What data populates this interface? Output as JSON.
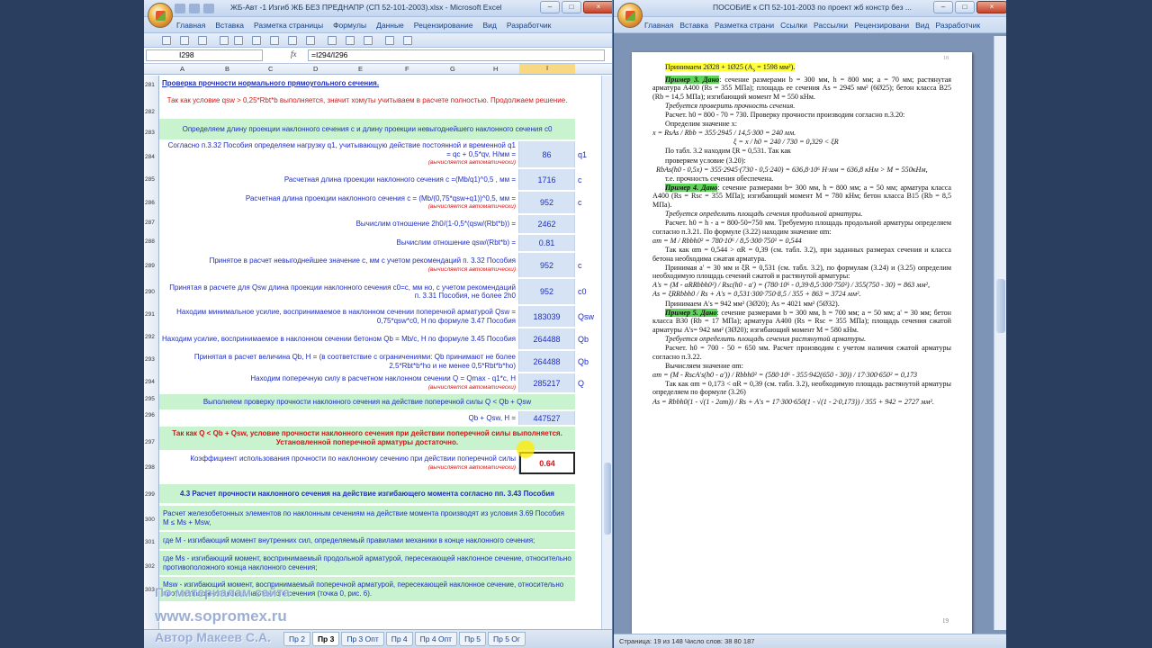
{
  "excel": {
    "title": "ЖБ-Авт -1 Изгиб ЖБ БЕЗ ПРЕДНАПР (СП 52-101-2003).xlsx - Microsoft Excel",
    "tabs": [
      "Главная",
      "Вставка",
      "Разметка страницы",
      "Формулы",
      "Данные",
      "Рецензирование",
      "Вид",
      "Разработчик"
    ],
    "name_box": "I298",
    "fx_label": "fx",
    "formula": "=I294/I296",
    "columns": [
      "A",
      "B",
      "C",
      "D",
      "E",
      "F",
      "G",
      "H",
      "I"
    ],
    "auto_note": "(вычисляется автоматически)",
    "heading": "Проверка прочности нормального прямоугольного сечения.",
    "red_note": "Так как условие qsw > 0,25*Rbt*b выполняется, значит хомуты учитываем в расчете полностью. Продолжаем решение.",
    "band_c0": "Определяем длину проекции наклонного сечения с и длину проекции невыгоднейшего наклонного сечения с0",
    "rows": [
      {
        "num": "284",
        "desc": "Согласно п.3.32 Пособия определяем нагрузку q1, учитывающую действие постоянной и временной q1 = qc + 0,5*qv, Н/мм =",
        "value": "86",
        "unit": "q1"
      },
      {
        "num": "285",
        "desc": "Расчетная длина проекции наклонного сечения с =(Mb/q1)^0,5 , мм =",
        "value": "1716",
        "unit": "c"
      },
      {
        "num": "286",
        "desc": "Расчетная длина проекции наклонного сечения  с = (Mb/(0,75*qsw+q1))^0,5, мм  =",
        "value": "952",
        "unit": "c"
      },
      {
        "num": "287",
        "desc": "Вычислим отношение    2h0/(1-0,5*(qsw/(Rbt*b)) =",
        "value": "2462",
        "unit": ""
      },
      {
        "num": "288",
        "desc": "Вычислим отношение  qsw/(Rbt*b) =",
        "value": "0.81",
        "unit": ""
      },
      {
        "num": "289",
        "desc": "Принятое в расчет невыгоднейшее значение с, мм с учетом рекомендаций п. 3.32 Пособия",
        "value": "952",
        "unit": "c"
      },
      {
        "num": "290",
        "desc": "Принятая в расчете для Qsw длина проекции наклонного сечения с0=с, мм но, с учетом рекомендаций п. 3.31 Пособия, не более 2h0",
        "value": "952",
        "unit": "c0"
      },
      {
        "num": "291",
        "desc": "Находим минимальное усилие, воспринимаемое в наклонном сечении поперечной арматурой Qsw = 0,75*qsw*c0, Н  по формуле 3.47 Пособия",
        "value": "183039",
        "unit": "Qsw"
      },
      {
        "num": "292",
        "desc": "Находим усилие, воспринимаемое в наклонном сечении бетоном Qb = Mb/c, Н  по формуле 3.45 Пособия",
        "value": "264488",
        "unit": "Qb"
      },
      {
        "num": "293",
        "desc": "Принятая в расчет величина Qb, Н  = (в соответствие с ограничениями: Qb принимают не более 2,5*Rbt*b*ho и не менее 0,5*Rbt*b*ho)",
        "value": "264488",
        "unit": "Qb"
      },
      {
        "num": "294",
        "desc": "Находим поперечную силу в расчетном наклонном сечении Q = Qmax - q1*c, Н",
        "value": "285217",
        "unit": "Q"
      }
    ],
    "band_check": "Выполняем проверку прочности наклонного сечения на действие поперечной силы Q < Qb + Qsw",
    "row_sum": {
      "desc": "Qb + Qsw, Н =",
      "value": "447527"
    },
    "conclusion": "Так как Q < Qb + Qsw, условие прочности наклонного сечения при действии поперечной силы выполняется. Установленной поперечной арматуры достаточно.",
    "row_coef": {
      "desc": "Коэффициент использования прочности по наклонному сечению при действии поперечной силы",
      "value": "0.64"
    },
    "section43": "4.3 Расчет прочности наклонного сечения на действие изгибающего момента согласно пп. 3.43 Пособия",
    "moment_rows": [
      "Расчет железобетонных элементов по наклонным сечениям на действие момента производят из условия 3.69 Пособия     M ≤ Ms + Msw,",
      "где M  - изгибающий момент внутренних сил, определяемый правилами механики в конце наклонного сечения;",
      "где Ms - изгибающий момент, воспринимаемый продольной арматурой, пересекающей наклонное сечение, относительно противоположного конца наклонного сечения;",
      "Msw - изгибающий момент, воспринимаемый поперечной арматурой, пересекающей наклонное сечение, относительно противоположного конца наклонного сечения (точка 0, рис. 6)."
    ],
    "sheets": [
      "Пр 2",
      "Пр 3",
      "Пр 3 Опт",
      "Пр 4",
      "Пр 4 Опт",
      "Пр 5",
      "Пр 5 Ог"
    ],
    "active_sheet": "Пр 3",
    "row_numbers": [
      "281",
      "282",
      "283",
      "284",
      "285",
      "286",
      "287",
      "288",
      "289",
      "290",
      "291",
      "292",
      "293",
      "294",
      "295",
      "296",
      "297",
      "298",
      "299",
      "300",
      "301",
      "302",
      "303"
    ]
  },
  "word": {
    "title": "ПОСОБИЕ к СП 52-101-2003 по проект жб констр без ...",
    "tabs": [
      "Главная",
      "Вставка",
      "Разметка страни",
      "Ссылки",
      "Рассылки",
      "Рецензировани",
      "Вид",
      "Разработчик"
    ],
    "page_top_number": "18",
    "line_accept_1": "Принимаем 2Ø28 + 1Ø25 (A",
    "line_accept_1b": "s",
    "line_accept_1c": " = 1598 мм²).",
    "ex3_label": "Пример 3. Дано",
    "ex3_text": ": сечение размерами b = 300 мм, h = 800 мм; a = 70 мм; растянутая арматура А400 (Rs = 355 МПа); площадь ее сечения As = 2945 мм² (6Ø25); бетон класса В25 (Rb = 14,5 МПа); изгибающий момент M = 550 кНм.",
    "ex3_req": "Требуется проверить прочность сечения.",
    "ex3_calc": "Расчет. h0 = 800 - 70 = 730. Проверку прочности производим согласно п.3.20:",
    "ex3_x": "Определим значение x:",
    "f1": "x = RsAs / Rbb = 355·2945 / 14,5·300 = 240 мм.",
    "f2": "ξ = x / h0 = 240 / 730 = 0,329 < ξR",
    "ex3_table": "По табл. 3.2 находим ξR = 0,531. Так как",
    "ex3_check": "проверяем условие (3.20):",
    "f3": "RbAs(h0 - 0,5x) = 355·2945·(730 - 0,5·240) = 636,8·10⁶ Н·мм = 636,8 кНм > M = 550кНм,",
    "ex3_result": "т.е. прочность сечения обеспечена.",
    "ex4_label": "Пример 4. Дано",
    "ex4_text": ": сечение размерами b= 300 мм, h = 800 мм; a = 50 мм; арматура класса А400 (Rs = Rsc = 355 МПа); изгибающий момент M = 780 кНм; бетон класса В15 (Rb = 8,5 МПа).",
    "ex4_req": "Требуется определить площадь сечения продольной арматуры.",
    "ex4_calc": "Расчет. h0 = h - a = 800-50=750 мм. Требуемую площадь продольной арматуры определяем согласно п.3.21. По формуле (3.22) находим значение αm:",
    "f4": "αm = M / Rbbh0² = 780·10⁶ / 8,5·300·750² = 0,544",
    "ex4_p1": "Так как αm = 0,544 > αR = 0,39 (см. табл. 3.2), при заданных размерах сечения и класса бетона необходима сжатая арматура.",
    "ex4_p2": "Принимая a' = 30 мм и ξR = 0,531 (см. табл. 3.2), по формулам (3.24) и (3.25) определим необходимую площадь сечений сжатой и растянутой арматуры:",
    "f5": "A's = (M - αRRbbh0²) / Rsc(h0 - a') = (780·10⁶ - 0,39·8,5·300·750²) / 355(750 - 30) = 863 мм²,",
    "f6": "As = ξRRbbh0 / Rs + A's = 0,531·300·750·8,5 / 355 + 863 = 3724 мм².",
    "ex4_accept": "Принимаем A's = 942 мм² (3Ø20); As = 4021 мм² (5Ø32).",
    "ex5_label": "Пример 5. Дано",
    "ex5_text": ": сечение размерами b = 300 мм, h = 700 мм; a = 50 мм; a' = 30 мм; бетон класса В30 (Rb = 17 МПа); арматура А400 (Rs = Rsc = 355 МПа); площадь сечения сжатой арматуры A's= 942 мм² (3Ø20); изгибающий момент M = 580 кНм.",
    "ex5_req": "Требуется определить площадь сечения растянутой арматуры.",
    "ex5_calc": "Расчет. h0 = 700 - 50 = 650 мм. Расчет производим с учетом наличия сжатой арматуры согласно п.3.22.",
    "ex5_am": "Вычисляем значение αm:",
    "f7": "αm = (M - RscA's(h0 - a')) / Rbbh0² = (580·10⁶ - 355·942(650 - 30)) / 17·300·650² = 0,173",
    "ex5_p": "Так как αm = 0,173 < αR = 0,39 (см. табл. 3.2), необходимую площадь растянутой арматуры определяем по формуле (3.26)",
    "f8": "As = Rbbh0(1 - √(1 - 2αm)) / Rs + A's = 17·300·650(1 - √(1 - 2·0,173)) / 355 + 942 = 2727 мм².",
    "page_number": "19",
    "status": "Страница: 19 из 148   Число слов: 38 80 187"
  },
  "watermark": {
    "line1": "По материалам сайта",
    "line2": "www.sopromex.ru",
    "line3": "Автор Макеев С.А."
  }
}
